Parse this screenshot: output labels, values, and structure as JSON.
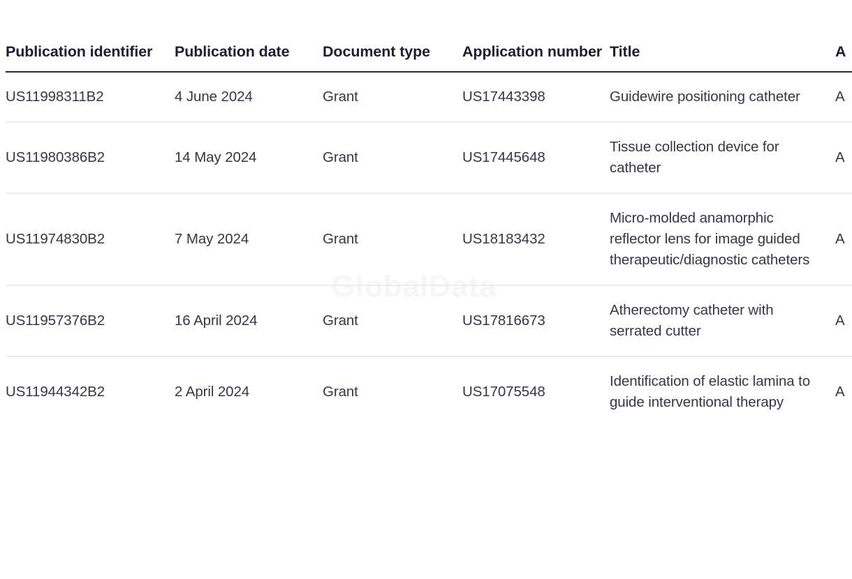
{
  "table": {
    "columns": [
      {
        "id": "publication-identifier",
        "label": "Publication identifier"
      },
      {
        "id": "publication-date",
        "label": "Publication date"
      },
      {
        "id": "document-type",
        "label": "Document type"
      },
      {
        "id": "application-number",
        "label": "Application number"
      },
      {
        "id": "title",
        "label": "Title"
      },
      {
        "id": "assignee",
        "label": "A"
      }
    ],
    "rows": [
      {
        "publication_identifier": "US11998311B2",
        "publication_date": "4 June 2024",
        "document_type": "Grant",
        "application_number": "US17443398",
        "title": "Guidewire positioning catheter",
        "assignee": "A"
      },
      {
        "publication_identifier": "US11980386B2",
        "publication_date": "14 May 2024",
        "document_type": "Grant",
        "application_number": "US17445648",
        "title": "Tissue collection device for catheter",
        "assignee": "A"
      },
      {
        "publication_identifier": "US11974830B2",
        "publication_date": "7 May 2024",
        "document_type": "Grant",
        "application_number": "US18183432",
        "title": "Micro-molded anamorphic reflector lens for image guided therapeutic/diagnostic catheters",
        "assignee": "A"
      },
      {
        "publication_identifier": "US11957376B2",
        "publication_date": "16 April 2024",
        "document_type": "Grant",
        "application_number": "US17816673",
        "title": "Atherectomy catheter with serrated cutter",
        "assignee": "A"
      },
      {
        "publication_identifier": "US11944342B2",
        "publication_date": "2 April 2024",
        "document_type": "Grant",
        "application_number": "US17075548",
        "title": "Identification of elastic lamina to guide interventional therapy",
        "assignee": "A"
      }
    ]
  },
  "watermark": {
    "text": "GlobalData",
    "color": "#f6f6f8"
  },
  "colors": {
    "header_text": "#1d1d33",
    "body_text": "#35364a",
    "header_rule": "#2c2c2c",
    "row_rule": "#ececee",
    "background": "#ffffff"
  }
}
